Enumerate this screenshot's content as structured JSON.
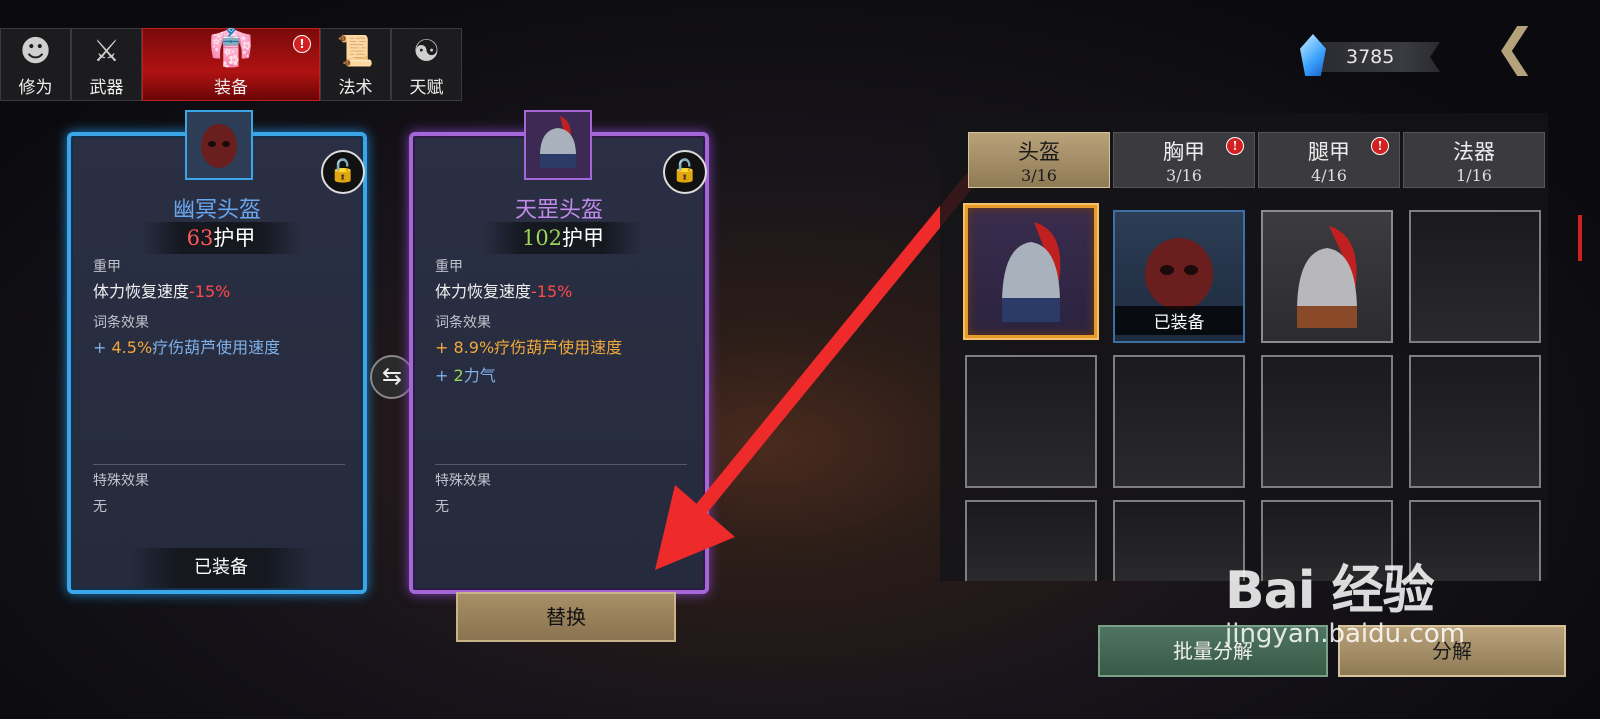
{
  "nav": {
    "tabs": [
      {
        "label": "修为",
        "icon": "monk-head-icon"
      },
      {
        "label": "武器",
        "icon": "sword-icon"
      },
      {
        "label": "装备",
        "icon": "robe-icon",
        "active": true,
        "alert": "!"
      },
      {
        "label": "法术",
        "icon": "scroll-icon"
      },
      {
        "label": "天赋",
        "icon": "yin-yang-icon"
      }
    ]
  },
  "currency": {
    "value": "3785",
    "icon": "crystal-gem-icon"
  },
  "left_card": {
    "name": "幽冥头盔",
    "armor_value": "63",
    "armor_label": "护甲",
    "type": "重甲",
    "stamina_label": "体力恢复速度",
    "stamina_value": "-15%",
    "affix_title": "词条效果",
    "affix_prefix": "+ ",
    "affix1_value": "4.5%",
    "affix1_text": "疗伤葫芦使用速度",
    "special_title": "特殊效果",
    "special_value": "无",
    "status": "已装备",
    "border_color": "#3aa6e8"
  },
  "right_card": {
    "name": "天罡头盔",
    "armor_value": "102",
    "armor_label": "护甲",
    "type": "重甲",
    "stamina_label": "体力恢复速度",
    "stamina_value": "-15%",
    "affix_title": "词条效果",
    "affix1_line": "+ 8.9%疗伤葫芦使用速度",
    "affix2_prefix": "+ ",
    "affix2_value": "2",
    "affix2_text": "力气",
    "special_title": "特殊效果",
    "special_value": "无",
    "border_color": "#a567d8"
  },
  "replace_button": "替换",
  "inventory": {
    "tabs": [
      {
        "name": "头盔",
        "count": "3/16",
        "active": true
      },
      {
        "name": "胸甲",
        "count": "3/16",
        "alert": "!"
      },
      {
        "name": "腿甲",
        "count": "4/16",
        "alert": "!"
      },
      {
        "name": "法器",
        "count": "1/16"
      }
    ],
    "equipped_label": "已装备"
  },
  "buttons": {
    "mass_decompose": "批量分解",
    "decompose": "分解"
  },
  "watermark": {
    "logo": "Bai  经验",
    "url": "jingyan.baidu.com"
  }
}
